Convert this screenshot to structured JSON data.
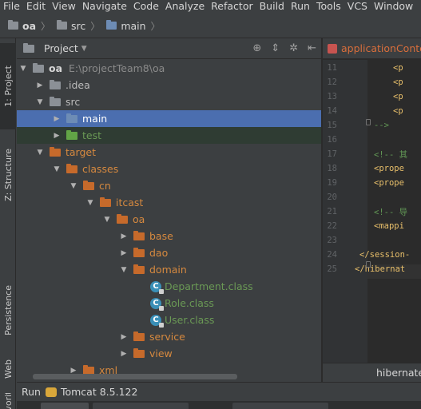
{
  "menu": [
    "File",
    "Edit",
    "View",
    "Navigate",
    "Code",
    "Analyze",
    "Refactor",
    "Build",
    "Run",
    "Tools",
    "VCS",
    "Window"
  ],
  "breadcrumb": [
    {
      "label": "oa",
      "sep": "〉"
    },
    {
      "label": "src",
      "sep": "〉"
    },
    {
      "label": "main",
      "sep": "〉"
    }
  ],
  "left_tabs": {
    "project": "1: Project",
    "structure": "Z: Structure",
    "persistence": "Persistence",
    "web": "Web",
    "favorites": "Favorites"
  },
  "project_panel": {
    "title": "Project",
    "tools": [
      "⊕",
      "⇕",
      "✲",
      "⇤"
    ]
  },
  "tree": [
    {
      "label": "oa",
      "extra": "E:\\projectTeam8\\oa",
      "arrow": "down",
      "icon": "grey",
      "indent": 0,
      "style": "bold"
    },
    {
      "label": ".idea",
      "arrow": "right",
      "icon": "grey",
      "indent": 1,
      "style": "plain"
    },
    {
      "label": "src",
      "arrow": "down",
      "icon": "grey",
      "indent": 1,
      "style": "plain"
    },
    {
      "label": "main",
      "arrow": "right",
      "icon": "blue",
      "indent": 2,
      "style": "plain",
      "state": "sel"
    },
    {
      "label": "test",
      "arrow": "right",
      "icon": "green",
      "indent": 2,
      "style": "plain",
      "state": "hl"
    },
    {
      "label": "target",
      "arrow": "down",
      "icon": "orange",
      "indent": 1,
      "style": "orange"
    },
    {
      "label": "classes",
      "arrow": "down",
      "icon": "orange",
      "indent": 2,
      "style": "orange"
    },
    {
      "label": "cn",
      "arrow": "down",
      "icon": "orange",
      "indent": 3,
      "style": "orange"
    },
    {
      "label": "itcast",
      "arrow": "down",
      "icon": "orange",
      "indent": 4,
      "style": "orange"
    },
    {
      "label": "oa",
      "arrow": "down",
      "icon": "orange",
      "indent": 5,
      "style": "orange"
    },
    {
      "label": "base",
      "arrow": "right",
      "icon": "orange",
      "indent": 6,
      "style": "orange"
    },
    {
      "label": "dao",
      "arrow": "right",
      "icon": "orange",
      "indent": 6,
      "style": "orange"
    },
    {
      "label": "domain",
      "arrow": "down",
      "icon": "orange",
      "indent": 6,
      "style": "orange"
    },
    {
      "label": "Department.class",
      "arrow": "none",
      "icon": "class",
      "indent": 7,
      "style": "green"
    },
    {
      "label": "Role.class",
      "arrow": "none",
      "icon": "class",
      "indent": 7,
      "style": "green"
    },
    {
      "label": "User.class",
      "arrow": "none",
      "icon": "class",
      "indent": 7,
      "style": "green"
    },
    {
      "label": "service",
      "arrow": "right",
      "icon": "orange",
      "indent": 6,
      "style": "orange"
    },
    {
      "label": "view",
      "arrow": "right",
      "icon": "orange",
      "indent": 6,
      "style": "orange"
    },
    {
      "label": "xml",
      "arrow": "right",
      "icon": "orange",
      "indent": 3,
      "style": "orange"
    }
  ],
  "editor": {
    "tab": "applicationConte",
    "footer": "hibernate",
    "lines": [
      {
        "num": "11",
        "text": "<p",
        "kind": "tag",
        "col": 112
      },
      {
        "num": "12",
        "text": "<p",
        "kind": "tag",
        "col": 112
      },
      {
        "num": "13",
        "text": "<p",
        "kind": "tag",
        "col": 112
      },
      {
        "num": "14",
        "text": "<p",
        "kind": "tag",
        "col": 112
      },
      {
        "num": "15",
        "text": "-->",
        "kind": "comment",
        "col": 88
      },
      {
        "num": "16",
        "text": "",
        "kind": "plain",
        "col": 88
      },
      {
        "num": "17",
        "text": "<!-- 其",
        "kind": "comment",
        "col": 88
      },
      {
        "num": "18",
        "text": "<prope",
        "kind": "tag",
        "col": 88
      },
      {
        "num": "19",
        "text": "<prope",
        "kind": "tag",
        "col": 88
      },
      {
        "num": "20",
        "text": "",
        "kind": "plain",
        "col": 88
      },
      {
        "num": "21",
        "text": "<!-- 导",
        "kind": "comment",
        "col": 88
      },
      {
        "num": "22",
        "text": "<mappi",
        "kind": "tag",
        "col": 88
      },
      {
        "num": "23",
        "text": "",
        "kind": "plain",
        "col": 70
      },
      {
        "num": "24",
        "text": "</session-",
        "kind": "tag",
        "col": 70
      },
      {
        "num": "25",
        "text": "</hibernat",
        "kind": "tag",
        "col": 64
      }
    ]
  },
  "run_bar": {
    "label": "Run",
    "config": "Tomcat 8.5.122"
  }
}
